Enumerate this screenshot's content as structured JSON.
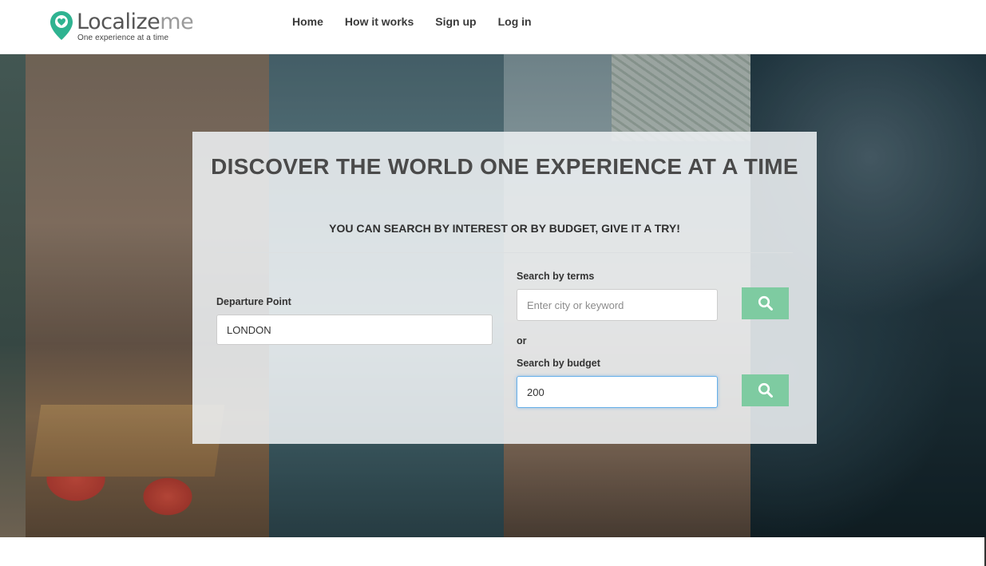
{
  "header": {
    "logo": {
      "word_primary": "Localize",
      "word_secondary": "me",
      "tagline": "One experience at a time",
      "pin_color": "#2fb391"
    },
    "nav": [
      {
        "label": "Home"
      },
      {
        "label": "How it works"
      },
      {
        "label": "Sign up"
      },
      {
        "label": "Log in"
      }
    ]
  },
  "search": {
    "headline": "DISCOVER THE WORLD ONE EXPERIENCE AT A TIME",
    "subheadline": "YOU CAN SEARCH BY INTEREST OR BY BUDGET, GIVE IT A TRY!",
    "departure": {
      "label": "Departure Point",
      "value": "LONDON"
    },
    "terms": {
      "label": "Search by terms",
      "value": "",
      "placeholder": "Enter city or keyword"
    },
    "or_label": "or",
    "budget": {
      "label": "Search by budget",
      "value": "200"
    },
    "button_icon": "search-icon",
    "accent_color": "#7ecba1"
  }
}
